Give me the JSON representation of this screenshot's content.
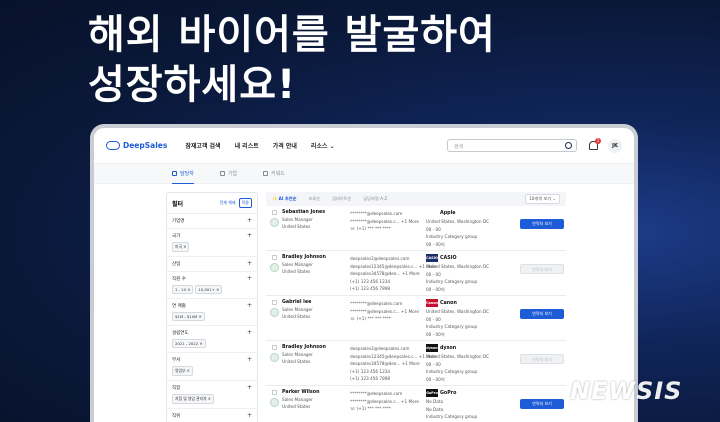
{
  "headline": {
    "line1": "해외 바이어를 발굴하여",
    "line2": "성장하세요!"
  },
  "app": {
    "logo": "DeepSales",
    "nav": [
      "잠재고객 검색",
      "내 리스트",
      "가격 안내",
      "리소스 ⌄"
    ],
    "search_placeholder": "검색",
    "notification_count": "1",
    "user_initials": "JK"
  },
  "tabs": [
    "담당자",
    "기업",
    "키워드"
  ],
  "filters": {
    "title": "필터",
    "clear": "전체 해제",
    "apply": "적용",
    "sections": [
      {
        "label": "기업명",
        "chips": []
      },
      {
        "label": "국가",
        "chips": [
          "미국 ✕"
        ]
      },
      {
        "label": "산업",
        "chips": []
      },
      {
        "label": "직원 수",
        "chips": [
          "1 - 10 ✕",
          "10,001+ ✕"
        ]
      },
      {
        "label": "연 매출",
        "chips": [
          "$1M - $10M ✕"
        ]
      },
      {
        "label": "설립연도",
        "chips": [
          "2021 - 2022 ✕"
        ]
      },
      {
        "label": "부서",
        "chips": [
          "영업부 ✕"
        ]
      },
      {
        "label": "직함",
        "chips": [
          "지점 및 영업 관리자 ✕"
        ]
      },
      {
        "label": "직위",
        "chips": []
      }
    ]
  },
  "sortbar": {
    "ai": "✨ AI 추천순",
    "options": [
      "조회순",
      "업데이트순",
      "담당자명 A-Z"
    ],
    "view": "10개씩 보기 ⌄"
  },
  "results": [
    {
      "name": "Sebastian Jones",
      "title": "Sales Manager",
      "location": "United States",
      "contact": [
        "********@deepsales.com",
        "********@deepsales.c...  +1 More",
        "☏ (+1) *** *** ****"
      ],
      "company": "Apple",
      "logo_color": "#ffffff",
      "logo_text": "",
      "company_info": [
        "United States, Washington DC",
        "00 - 00",
        "Industry Category group",
        "00 - 00억"
      ],
      "button": "연락처 보기",
      "disabled": false
    },
    {
      "name": "Bradley Johnson",
      "title": "Sales Manager",
      "location": "United States",
      "contact": [
        "deepsales2@deepsales.com",
        "deepsales12345@deepsales.c...  +1 More",
        "deepsales34578@dee...  +1 More",
        "(+1) 123 456 1234",
        "(+1) 123 456 7898"
      ],
      "company": "CASIO",
      "logo_color": "#1b2d6b",
      "logo_text": "CASIO",
      "company_info": [
        "United States, Washington DC",
        "00 - 00",
        "Industry Category group",
        "00 - 00억"
      ],
      "button": "연락처 보기",
      "disabled": true
    },
    {
      "name": "Gabriel lee",
      "title": "Sales Manager",
      "location": "United States",
      "contact": [
        "********@deepsales.com",
        "********@deepsales.c...  +1 More",
        "☏ (+1) *** *** ****"
      ],
      "company": "Canon",
      "logo_color": "#c8102e",
      "logo_text": "Canon",
      "company_info": [
        "United States, Washington DC",
        "00 - 00",
        "Industry Category group",
        "00 - 00억"
      ],
      "button": "연락처 보기",
      "disabled": false
    },
    {
      "name": "Bradley Johnson",
      "title": "Sales Manager",
      "location": "United States",
      "contact": [
        "deepsales2@deepsales.com",
        "deepsales12345@deepsales.c...  +1 More",
        "deepsales34578@dee...  +1 More",
        "(+1) 123 456 1234",
        "(+1) 123 456 7898"
      ],
      "company": "dyson",
      "logo_color": "#111111",
      "logo_text": "dyson",
      "company_info": [
        "United States, Washington DC",
        "00 - 00",
        "Industry Category group",
        "00 - 00억"
      ],
      "button": "연락처 보기",
      "disabled": true
    },
    {
      "name": "Parker Wilson",
      "title": "Sales Manager",
      "location": "United States",
      "contact": [
        "********@deepsales.com",
        "********@deepsales.c...  +1 More",
        "☏ (+1) *** *** ****"
      ],
      "company": "GoPro",
      "logo_color": "#111111",
      "logo_text": "GoPro",
      "company_info": [
        "No Data",
        "No Data",
        "Industry Category group",
        "00 - 00억"
      ],
      "button": "연락처 보기",
      "disabled": false
    }
  ],
  "watermark": "NEWSIS"
}
